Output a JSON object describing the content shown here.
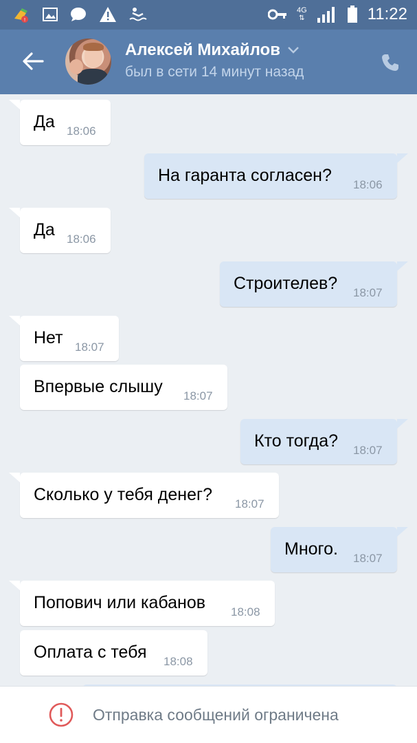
{
  "status_bar": {
    "time": "11:22",
    "network": "4G",
    "icons": [
      "cleaner-icon",
      "gallery-icon",
      "chat-icon",
      "warning-icon",
      "vpn-key-icon",
      "signal-icon",
      "battery-icon"
    ]
  },
  "header": {
    "name": "Алексей Михайлов",
    "status": "был в сети 14 минут назад",
    "accent": "#5a7fad"
  },
  "messages": [
    {
      "dir": "in",
      "text": "Да",
      "time": "18:06"
    },
    {
      "dir": "out",
      "text": "На гаранта согласен?",
      "time": "18:06"
    },
    {
      "dir": "in",
      "text": "Да",
      "time": "18:06"
    },
    {
      "dir": "out",
      "text": "Строителев?",
      "time": "18:07"
    },
    {
      "dir": "in",
      "text": "Нет",
      "time": "18:07"
    },
    {
      "dir": "in",
      "text": "Впервые слышу",
      "time": "18:07"
    },
    {
      "dir": "out",
      "text": "Кто тогда?",
      "time": "18:07"
    },
    {
      "dir": "in",
      "text": "Сколько у тебя денег?",
      "time": "18:07"
    },
    {
      "dir": "out",
      "text": "Много.",
      "time": "18:07"
    },
    {
      "dir": "in",
      "text": "Попович или кабанов",
      "time": "18:08"
    },
    {
      "dir": "in",
      "text": "Оплата с тебя",
      "time": "18:08"
    }
  ],
  "bottom": {
    "notice": "Отправка сообщений ограничена",
    "icon": "alert-circle-icon",
    "icon_color": "#e05a5a"
  }
}
